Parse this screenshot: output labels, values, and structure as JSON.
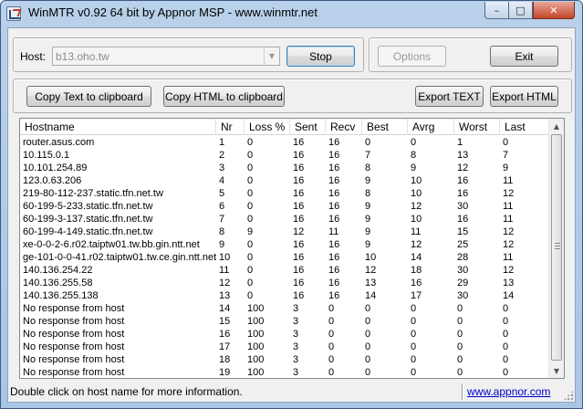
{
  "window": {
    "title": "WinMTR v0.92 64 bit by Appnor MSP - www.winmtr.net",
    "min_glyph": "–",
    "max_glyph": "□",
    "close_glyph": "✕"
  },
  "controls": {
    "host_label": "Host:",
    "host_value": "b13.oho.tw",
    "stop_label": "Stop",
    "options_label": "Options",
    "exit_label": "Exit",
    "copy_text_label": "Copy Text to clipboard",
    "copy_html_label": "Copy HTML to clipboard",
    "export_text_label": "Export TEXT",
    "export_html_label": "Export HTML"
  },
  "table": {
    "columns": [
      "Hostname",
      "Nr",
      "Loss %",
      "Sent",
      "Recv",
      "Best",
      "Avrg",
      "Worst",
      "Last"
    ],
    "rows": [
      [
        "router.asus.com",
        "1",
        "0",
        "16",
        "16",
        "0",
        "0",
        "1",
        "0"
      ],
      [
        "10.115.0.1",
        "2",
        "0",
        "16",
        "16",
        "7",
        "8",
        "13",
        "7"
      ],
      [
        "10.101.254.89",
        "3",
        "0",
        "16",
        "16",
        "8",
        "9",
        "12",
        "9"
      ],
      [
        "123.0.63.206",
        "4",
        "0",
        "16",
        "16",
        "9",
        "10",
        "16",
        "11"
      ],
      [
        "219-80-112-237.static.tfn.net.tw",
        "5",
        "0",
        "16",
        "16",
        "8",
        "10",
        "16",
        "12"
      ],
      [
        "60-199-5-233.static.tfn.net.tw",
        "6",
        "0",
        "16",
        "16",
        "9",
        "12",
        "30",
        "11"
      ],
      [
        "60-199-3-137.static.tfn.net.tw",
        "7",
        "0",
        "16",
        "16",
        "9",
        "10",
        "16",
        "11"
      ],
      [
        "60-199-4-149.static.tfn.net.tw",
        "8",
        "9",
        "12",
        "11",
        "9",
        "11",
        "15",
        "12"
      ],
      [
        "xe-0-0-2-6.r02.taiptw01.tw.bb.gin.ntt.net",
        "9",
        "0",
        "16",
        "16",
        "9",
        "12",
        "25",
        "12"
      ],
      [
        "ge-101-0-0-41.r02.taiptw01.tw.ce.gin.ntt.net",
        "10",
        "0",
        "16",
        "16",
        "10",
        "14",
        "28",
        "11"
      ],
      [
        "140.136.254.22",
        "11",
        "0",
        "16",
        "16",
        "12",
        "18",
        "30",
        "12"
      ],
      [
        "140.136.255.58",
        "12",
        "0",
        "16",
        "16",
        "13",
        "16",
        "29",
        "13"
      ],
      [
        "140.136.255.138",
        "13",
        "0",
        "16",
        "16",
        "14",
        "17",
        "30",
        "14"
      ],
      [
        "No response from host",
        "14",
        "100",
        "3",
        "0",
        "0",
        "0",
        "0",
        "0"
      ],
      [
        "No response from host",
        "15",
        "100",
        "3",
        "0",
        "0",
        "0",
        "0",
        "0"
      ],
      [
        "No response from host",
        "16",
        "100",
        "3",
        "0",
        "0",
        "0",
        "0",
        "0"
      ],
      [
        "No response from host",
        "17",
        "100",
        "3",
        "0",
        "0",
        "0",
        "0",
        "0"
      ],
      [
        "No response from host",
        "18",
        "100",
        "3",
        "0",
        "0",
        "0",
        "0",
        "0"
      ],
      [
        "No response from host",
        "19",
        "100",
        "3",
        "0",
        "0",
        "0",
        "0",
        "0"
      ]
    ]
  },
  "scrollbar": {
    "up_glyph": "▲",
    "down_glyph": "▼"
  },
  "status": {
    "message": "Double click on host name for more information.",
    "link": "www.appnor.com"
  },
  "colors": {
    "frame": "#b9d1ea",
    "client_bg": "#f0f0f0",
    "close_button": "#c4452b",
    "link": "#0000cc"
  }
}
